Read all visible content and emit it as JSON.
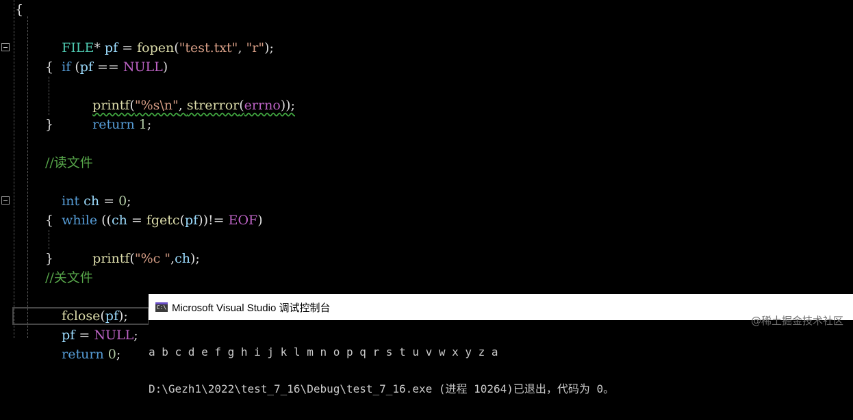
{
  "editor": {
    "open_brace": "{",
    "lines": {
      "l1": {
        "type": "FILE",
        "op": "* ",
        "var": "pf",
        "eq": " = ",
        "fn": "fopen",
        "p1": "(",
        "s1": "\"test.txt\"",
        "c": ", ",
        "s2": "\"r\"",
        "end": ");"
      },
      "l2": {
        "kw": "if",
        "a": " (",
        "var": "pf",
        "b": " == ",
        "mac": "NULL",
        "c": ")"
      },
      "l3": "{",
      "l4": {
        "fn": "printf",
        "a": "(",
        "s": "\"%s\\n\"",
        "b": ", ",
        "fn2": "strerror",
        "c": "(",
        "var": "errno",
        "d": "));"
      },
      "l5": {
        "kw": "return",
        "sp": " ",
        "num": "1",
        "end": ";"
      },
      "l6": "}",
      "l7": "//读文件",
      "l8": {
        "kw": "int",
        "sp": " ",
        "var": "ch",
        "eq": " = ",
        "num": "0",
        "end": ";"
      },
      "l9": {
        "kw": "while",
        "a": " ((",
        "var": "ch",
        "b": " = ",
        "fn": "fgetc",
        "c": "(",
        "var2": "pf",
        "d": "))!= ",
        "mac": "EOF",
        "e": ")"
      },
      "l10": "{",
      "l11": {
        "fn": "printf",
        "a": "(",
        "s": "\"%c \"",
        "b": ",",
        "var": "ch",
        "c": ");"
      },
      "l12": "}",
      "l13": "//关文件",
      "l14": {
        "fn": "fclose",
        "a": "(",
        "var": "pf",
        "b": ");"
      },
      "l15": {
        "var": "pf",
        "eq": " = ",
        "mac": "NULL",
        "end": ";"
      },
      "l16": {
        "kw": "return",
        "sp": " ",
        "num": "0",
        "end": ";"
      }
    }
  },
  "console": {
    "title": "Microsoft Visual Studio 调试控制台",
    "icon_text": "C:\\",
    "output_line1": "a b c d e f g h i j k l m n o p q r s t u v w x y z a",
    "output_line2": "D:\\Gezh1\\2022\\test_7_16\\Debug\\test_7_16.exe (进程 10264)已退出，代码为 0。"
  },
  "watermark": "@稀土掘金技术社区",
  "colors": {
    "keyword": "#569cd6",
    "type": "#4ec9b0",
    "function": "#dcdcaa",
    "identifier": "#9cdcfe",
    "string": "#d69d85",
    "comment": "#57a64a",
    "macro": "#bd63c5"
  }
}
